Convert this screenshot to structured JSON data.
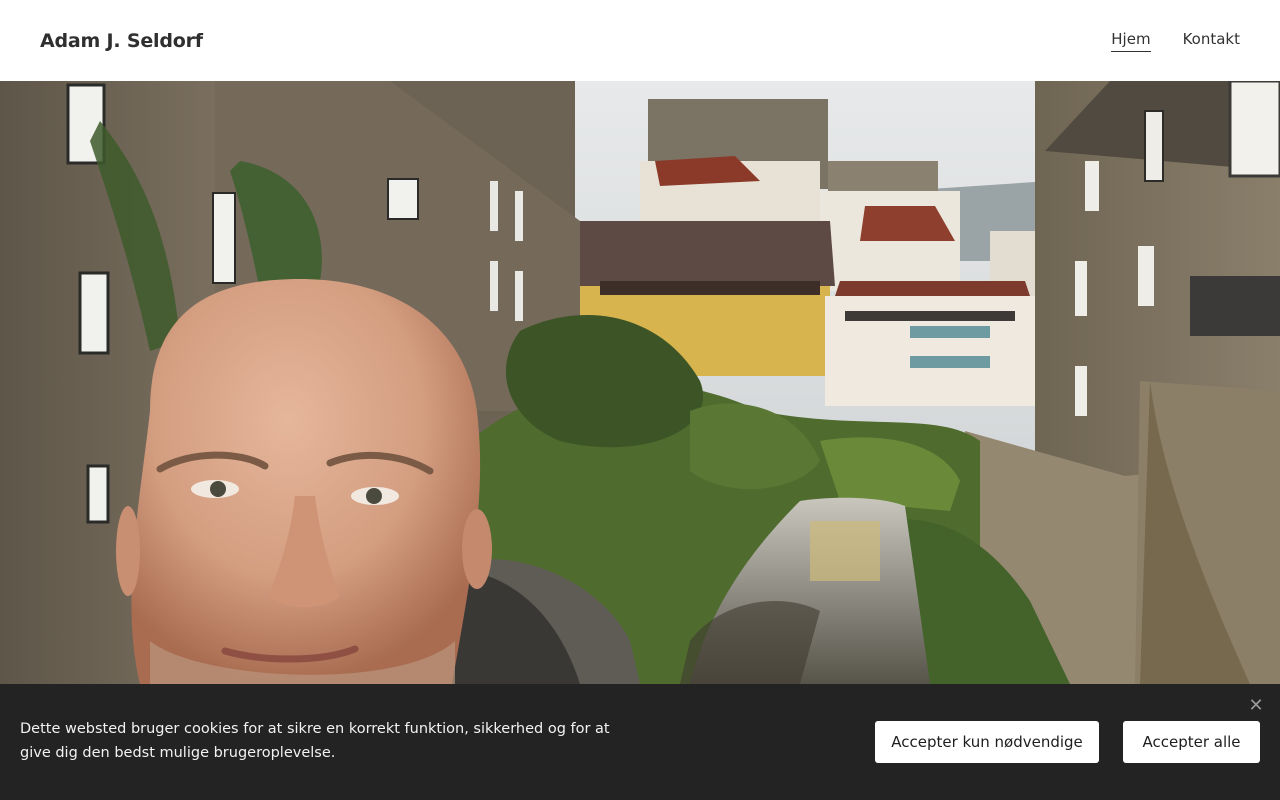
{
  "header": {
    "site_title": "Adam J. Seldorf",
    "nav": [
      {
        "label": "Hjem",
        "active": true
      },
      {
        "label": "Kontakt",
        "active": false
      }
    ]
  },
  "hero": {
    "image_description_icon": "hero-photo"
  },
  "cookie_banner": {
    "text": "Dette websted bruger cookies for at sikre en korrekt funktion, sikkerhed og for at give dig den bedst mulige brugeroplevelse.",
    "close_icon": "close-icon",
    "buttons": {
      "necessary": "Accepter kun nødvendige",
      "all": "Accepter alle"
    }
  },
  "colors": {
    "header_bg": "#ffffff",
    "banner_bg": "#232323",
    "button_bg": "#ffffff",
    "text_dark": "#2f2f2f"
  }
}
